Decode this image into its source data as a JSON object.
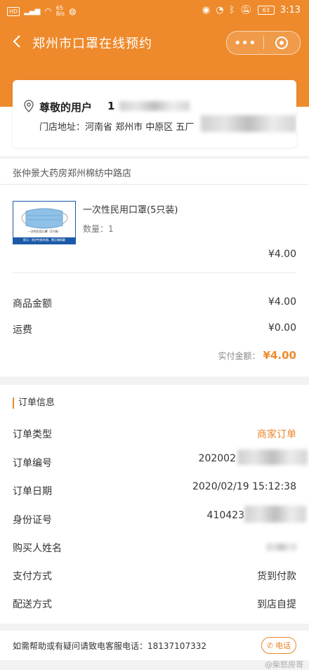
{
  "status_bar": {
    "signal": "HD",
    "net": "4G",
    "speed": "65\nB/s",
    "battery": "63",
    "time": "3:13"
  },
  "nav": {
    "title": "郑州市口罩在线预约",
    "more": "•••"
  },
  "address": {
    "greeting": "尊敬的用户",
    "phone_prefix": "1",
    "address_line": "门店地址：河南省 郑州市 中原区 五厂"
  },
  "store": {
    "name": "张仲景大药房郑州棉纺中路店"
  },
  "product": {
    "name": "一次性民用口罩(5只装)",
    "quantity_label": "数量：1",
    "price": "¥4.00",
    "thumb_caption": "一次性民用口罩（5只装）",
    "thumb_note": "提示：防护性能有限，需正确佩戴"
  },
  "summary": {
    "goods_label": "商品金额",
    "goods_value": "¥4.00",
    "shipping_label": "运费",
    "shipping_value": "¥0.00",
    "paid_label": "实付金额：",
    "paid_value": "¥4.00"
  },
  "order": {
    "section_title": "订单信息",
    "rows": [
      {
        "label": "订单类型",
        "value": "商家订单"
      },
      {
        "label": "订单编号",
        "value": "202002"
      },
      {
        "label": "订单日期",
        "value": "2020/02/19 15:12:38"
      },
      {
        "label": "身份证号",
        "value": "410423"
      },
      {
        "label": "购买人姓名",
        "value": ""
      },
      {
        "label": "支付方式",
        "value": "货到付款"
      },
      {
        "label": "配送方式",
        "value": "到店自提"
      }
    ]
  },
  "footer": {
    "help_text": "如需帮助或有疑问请致电客服电话：18137107332",
    "call_label": "电话"
  },
  "watermark": "@柴怒房哥",
  "colors": {
    "accent": "#ee8a2b"
  }
}
